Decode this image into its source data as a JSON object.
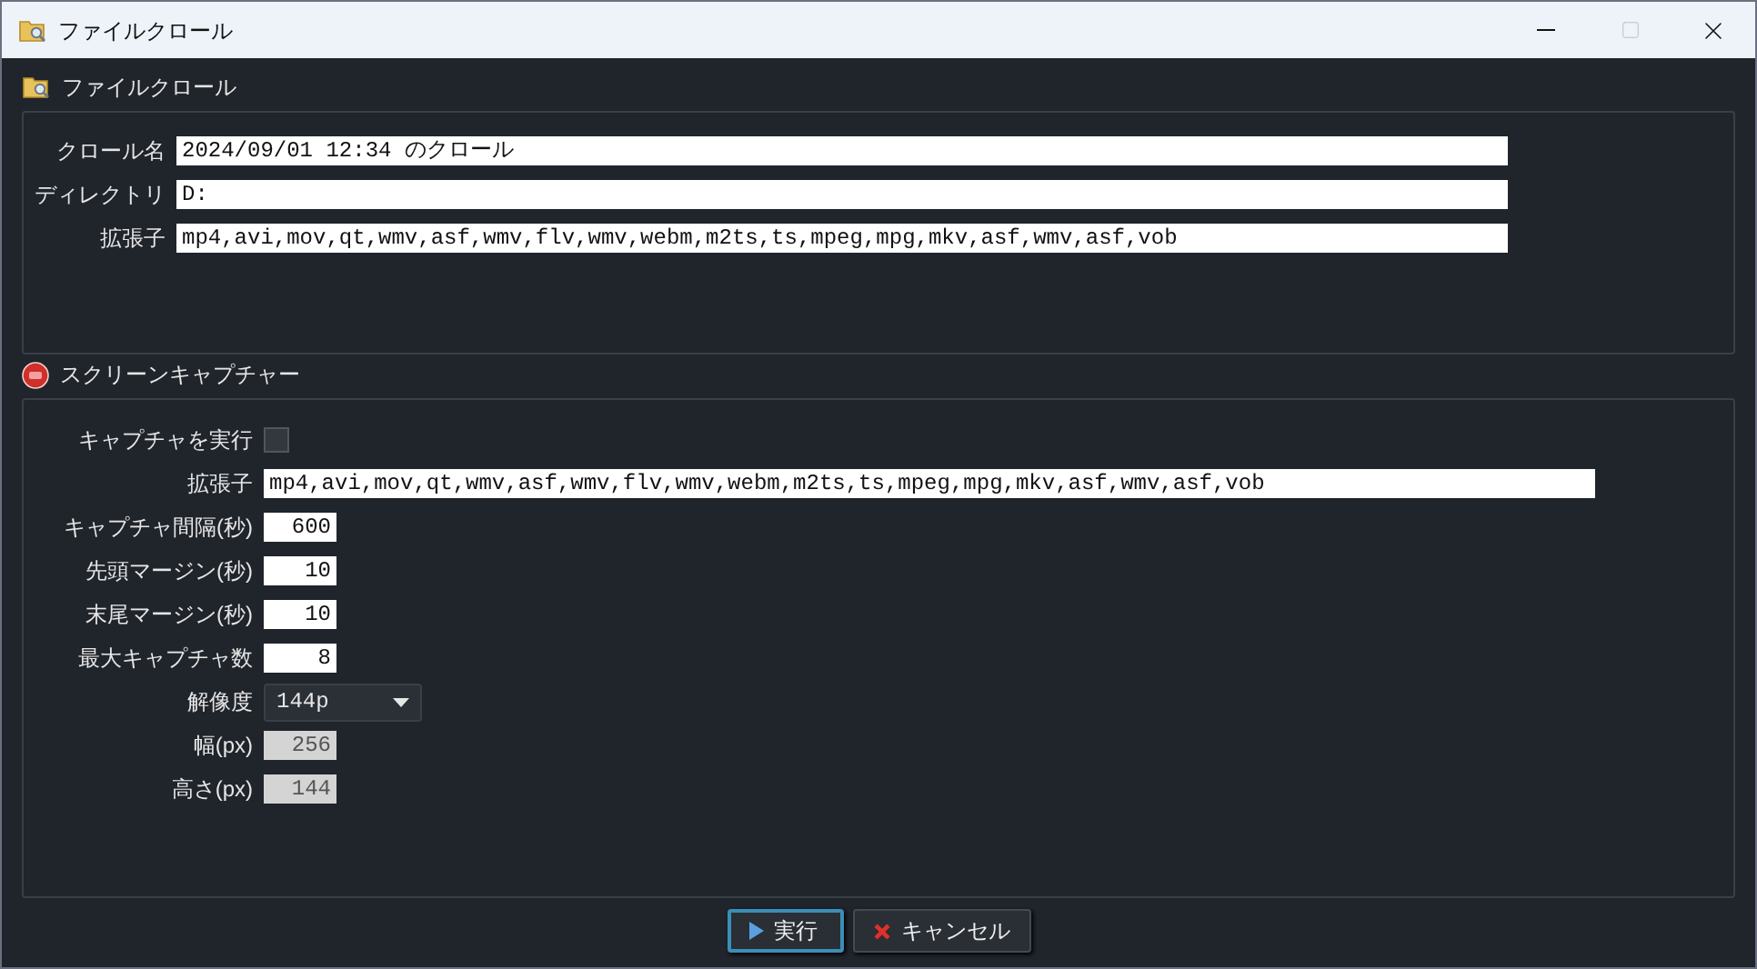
{
  "window": {
    "title": "ファイルクロール"
  },
  "crawl_section": {
    "title": "ファイルクロール",
    "fields": [
      {
        "label": "クロール名",
        "value": "2024/09/01 12:34 のクロール"
      },
      {
        "label": "ディレクトリ",
        "value": "D:"
      },
      {
        "label": "拡張子",
        "value": "mp4,avi,mov,qt,wmv,asf,wmv,flv,wmv,webm,m2ts,ts,mpeg,mpg,mkv,asf,wmv,asf,vob"
      }
    ]
  },
  "capture_section": {
    "title": "スクリーンキャプチャー",
    "rows": [
      {
        "kind": "checkbox",
        "label": "キャプチャを実行",
        "checked": false
      },
      {
        "kind": "text",
        "label": "拡張子",
        "value": "mp4,avi,mov,qt,wmv,asf,wmv,flv,wmv,webm,m2ts,ts,mpeg,mpg,mkv,asf,wmv,asf,vob"
      },
      {
        "kind": "number",
        "label": "キャプチャ間隔(秒)",
        "value": "600",
        "disabled": false
      },
      {
        "kind": "number",
        "label": "先頭マージン(秒)",
        "value": "10",
        "disabled": false
      },
      {
        "kind": "number",
        "label": "末尾マージン(秒)",
        "value": "10",
        "disabled": false
      },
      {
        "kind": "number",
        "label": "最大キャプチャ数",
        "value": "8",
        "disabled": false
      },
      {
        "kind": "select",
        "label": "解像度",
        "value": "144p"
      },
      {
        "kind": "number",
        "label": "幅(px)",
        "value": "256",
        "disabled": true
      },
      {
        "kind": "number",
        "label": "高さ(px)",
        "value": "144",
        "disabled": true
      }
    ]
  },
  "buttons": [
    {
      "kind": "run",
      "label": "実行",
      "focused": true
    },
    {
      "kind": "cancel",
      "label": "キャンセル",
      "focused": false
    }
  ]
}
